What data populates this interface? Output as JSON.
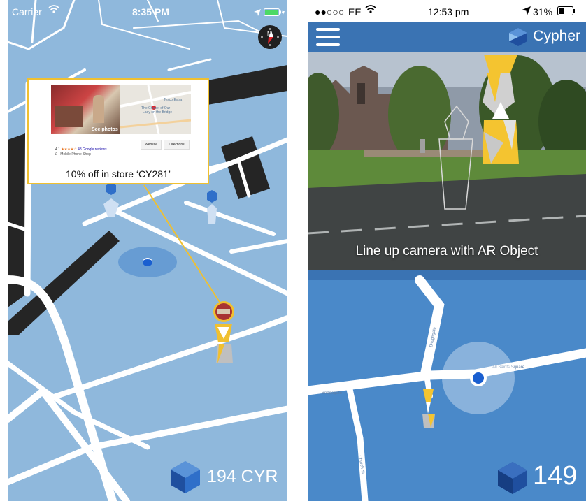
{
  "left_screen": {
    "status_bar": {
      "carrier": "Carrier",
      "wifi_icon": "wifi-icon",
      "time": "8:35 PM",
      "location_icon": "location-arrow-icon",
      "battery_icon": "battery-charging-icon"
    },
    "compass": {
      "icon": "compass-icon",
      "label": "N"
    },
    "popup": {
      "photo_button": "See photos",
      "map_labels": [
        "Tesco Extra",
        "The Chapel of Our",
        "Lady on the Bridge"
      ],
      "rating": "4.1",
      "stars": "★★★★☆",
      "reviews": "48 Google reviews",
      "category": "£ · Mobile Phone Shop",
      "website_button": "Website",
      "directions_button": "Directions",
      "offer": "10% off in store ‘CY281’"
    },
    "balance": "194 CYR",
    "colors": {
      "map_bg": "#8fb8dc",
      "roads": "#ffffff",
      "accent": "#f0c030",
      "cube": "#2f6fc9"
    }
  },
  "right_screen": {
    "status_bar": {
      "signal": "●●○○○",
      "carrier": "EE",
      "wifi_icon": "wifi-icon",
      "time": "12:53 pm",
      "location_icon": "location-arrow-icon",
      "battery": "31%",
      "battery_icon": "battery-icon"
    },
    "header": {
      "menu_icon": "hamburger-menu-icon",
      "brand": "Cypher",
      "logo_icon": "cypher-cube-icon"
    },
    "camera": {
      "hint": "Line up camera with AR Object"
    },
    "map": {
      "street_labels": [
        "Bridgegate",
        "All Saints Square",
        "Bridgegate",
        "Church St"
      ]
    },
    "balance": "149",
    "colors": {
      "header_bg": "#3a73b3",
      "map_bg": "#4a89c9",
      "accent": "#f4c430"
    }
  }
}
